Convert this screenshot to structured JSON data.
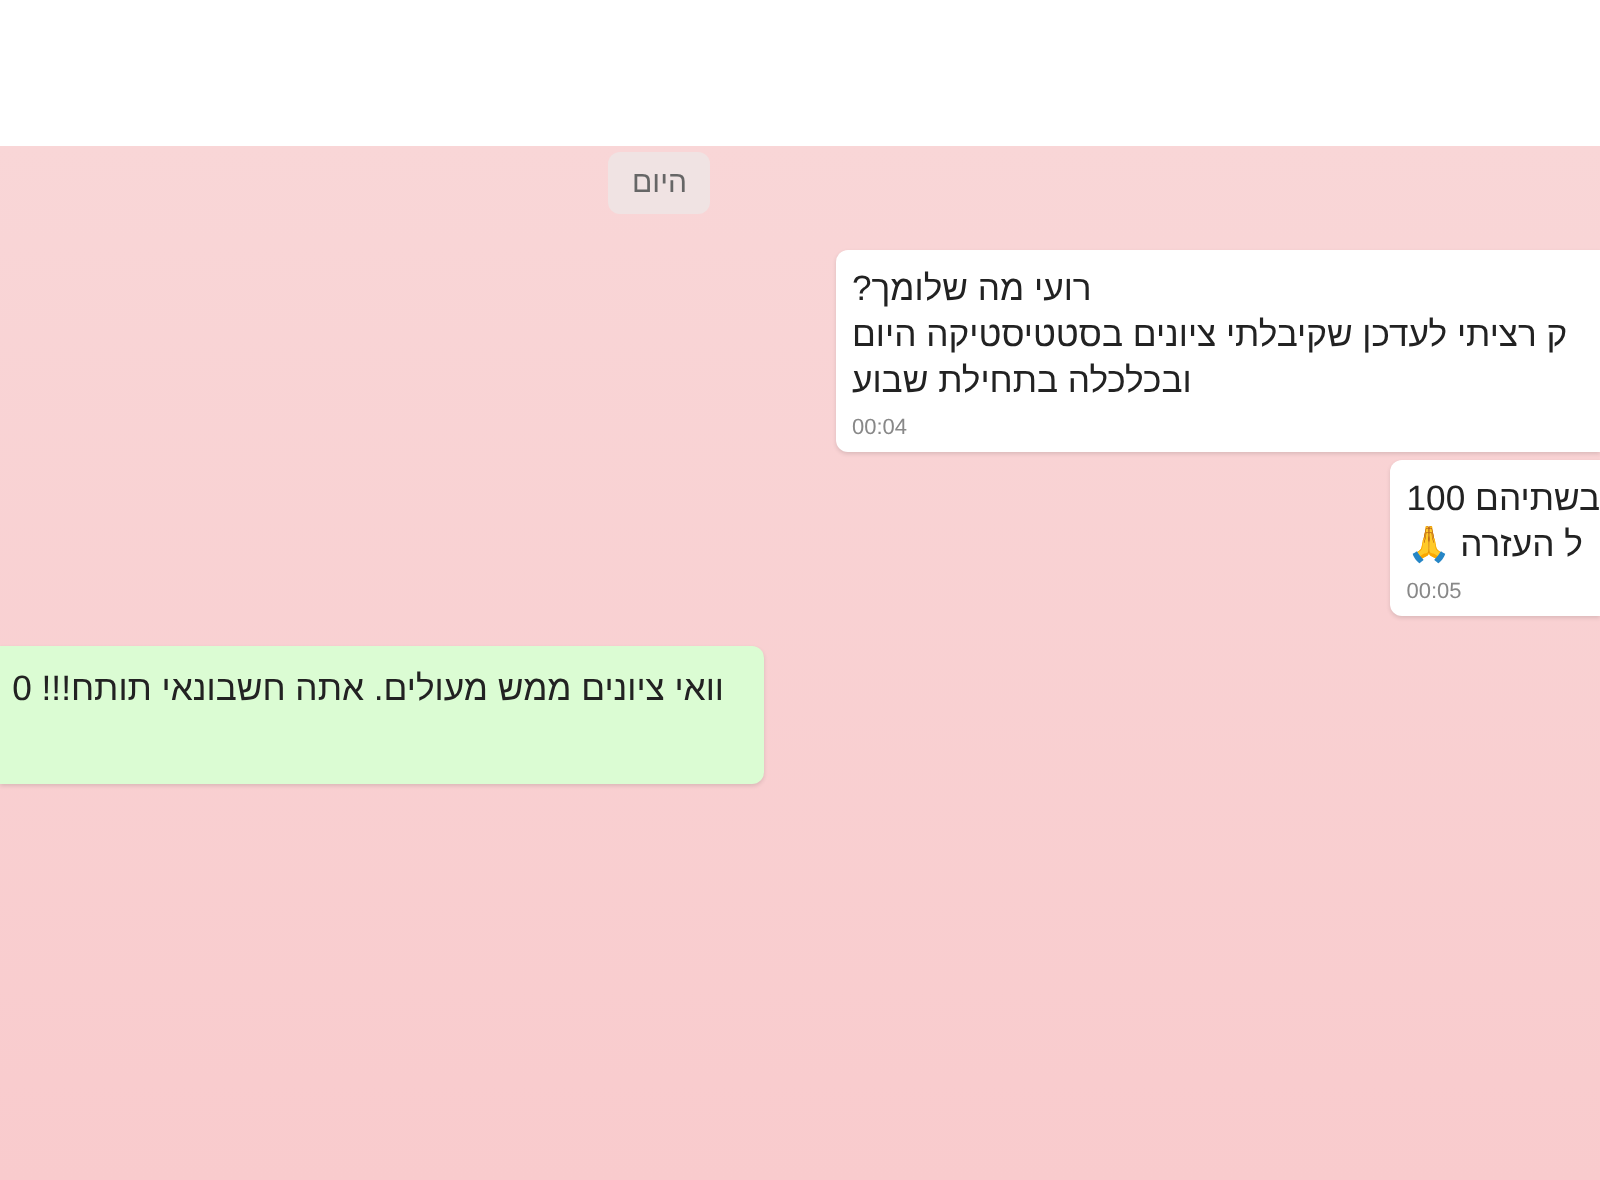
{
  "date_chip": "היום",
  "messages": [
    {
      "kind": "outgoing",
      "lines": [
        "רועי מה שלומך?",
        "ק רציתי לעדכן שקיבלתי ציונים בסטטיסטיקה היום",
        "ובכלכלה בתחילת שבוע"
      ],
      "time": "00:04"
    },
    {
      "kind": "outgoing",
      "lines": [
        "בשתיהם 100",
        "ל העזרה 🙏"
      ],
      "time": "00:05"
    },
    {
      "kind": "incoming",
      "lines": [
        "וואי ציונים ממש מעולים. אתה חשבונאי תותח!!! 0"
      ]
    }
  ]
}
